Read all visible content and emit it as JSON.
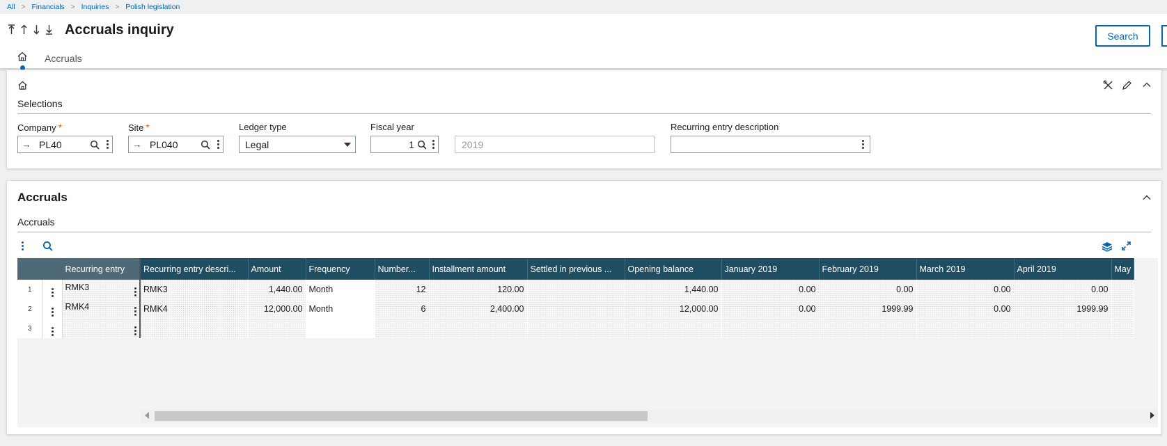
{
  "breadcrumb": [
    "All",
    "Financials",
    "Inquiries",
    "Polish legislation"
  ],
  "header": {
    "title": "Accruals inquiry",
    "search_label": "Search",
    "tab_label": "Accruals"
  },
  "selections": {
    "title": "Selections",
    "company": {
      "label": "Company",
      "value": "PL40",
      "required": "*"
    },
    "site": {
      "label": "Site",
      "value": "PL040",
      "required": "*"
    },
    "ledger_type": {
      "label": "Ledger type",
      "value": "Legal"
    },
    "fiscal_year": {
      "label": "Fiscal year",
      "value": "1",
      "display": "2019"
    },
    "recurring_desc": {
      "label": "Recurring entry description",
      "value": ""
    }
  },
  "accruals": {
    "section_title": "Accruals",
    "grid_title": "Accruals",
    "columns": [
      "Recurring entry",
      "Recurring entry descri...",
      "Amount",
      "Frequency",
      "Number...",
      "Installment amount",
      "Settled in previous ...",
      "Opening balance",
      "January 2019",
      "February 2019",
      "March 2019",
      "April 2019",
      "May"
    ],
    "rows": [
      {
        "n": "1",
        "entry": "RMK3",
        "desc": "RMK3",
        "amount": "1,440.00",
        "freq": "Month",
        "number": "12",
        "install": "120.00",
        "settled": "",
        "opening": "1,440.00",
        "jan": "0.00",
        "feb": "0.00",
        "mar": "0.00",
        "apr": "0.00",
        "may": ""
      },
      {
        "n": "2",
        "entry": "RMK4",
        "desc": "RMK4",
        "amount": "12,000.00",
        "freq": "Month",
        "number": "6",
        "install": "2,400.00",
        "settled": "",
        "opening": "12,000.00",
        "jan": "0.00",
        "feb": "1999.99",
        "mar": "0.00",
        "apr": "1999.99",
        "may": ""
      },
      {
        "n": "3",
        "entry": "",
        "desc": "",
        "amount": "",
        "freq": "",
        "number": "",
        "install": "",
        "settled": "",
        "opening": "",
        "jan": "",
        "feb": "",
        "mar": "",
        "apr": "",
        "may": ""
      }
    ]
  },
  "colors": {
    "accent": "#0a65b0",
    "grid_header": "#1f4e63",
    "required": "#e85a1a"
  }
}
